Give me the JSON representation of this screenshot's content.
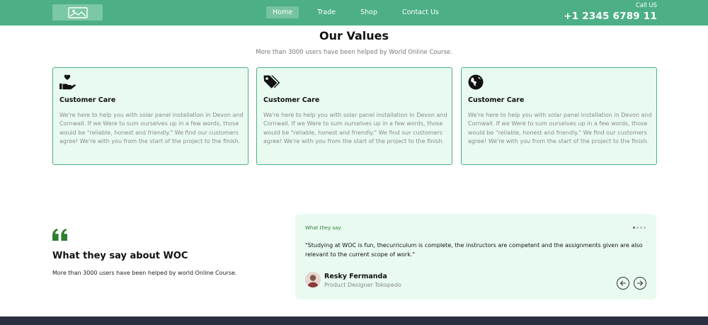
{
  "header": {
    "logo_icon": "image-placeholder-icon",
    "nav": [
      {
        "label": "Home",
        "active": true
      },
      {
        "label": "Trade",
        "active": false
      },
      {
        "label": "Shop",
        "active": false
      },
      {
        "label": "Contact Us",
        "active": false
      }
    ],
    "call_label": "Call US",
    "call_number": "+1 2345 6789 11"
  },
  "values": {
    "title": "Our Values",
    "subtitle": "More than 3000 users have been helped by World Online Course.",
    "cards": [
      {
        "icon": "hand-heart-icon",
        "title": "Customer Care",
        "text": "We're here to help you with solar panel installation in Devon and Cornwall. If we Were to sum ourselves up in a few words, those would be \"reliable, honest and friendly.\" We find our customers agree! We're with you from the start of the project to the finish."
      },
      {
        "icon": "tags-icon",
        "title": "Customer Care",
        "text": "We're here to help you with solar panel installation in Devon and Cornwall. If we Were to sum ourselves up in a few words, those would be \"reliable, honest and friendly.\" We find our customers agree! We're with you from the start of the project to the finish."
      },
      {
        "icon": "globe-icon",
        "title": "Customer Care",
        "text": "We're here to help you with solar panel installation in Devon and Cornwall. If we Were to sum ourselves up in a few words, those would be \"reliable, honest and friendly.\" We find our customers agree! We're with you from the start of the project to the finish."
      }
    ]
  },
  "testimonials": {
    "quote_icon": "quote-icon",
    "title": "What they say about WOC",
    "subtitle": "More than 3000 users have been helped by world Online Course.",
    "card": {
      "label": "What they say",
      "quote": "\"Studying at WOC is fun, thecurriculum is complete, the instructors are competent and the assignments given are also relevant to the current scope of work.\"",
      "name": "Resky Fermanda",
      "role": "Product Designer Tokopedo",
      "slides": 4,
      "active_slide": 1
    }
  },
  "colors": {
    "brand": "#4caf86",
    "card_bg": "#e9faf1",
    "footer": "#2b3040",
    "quote_green": "#2e7d32"
  }
}
